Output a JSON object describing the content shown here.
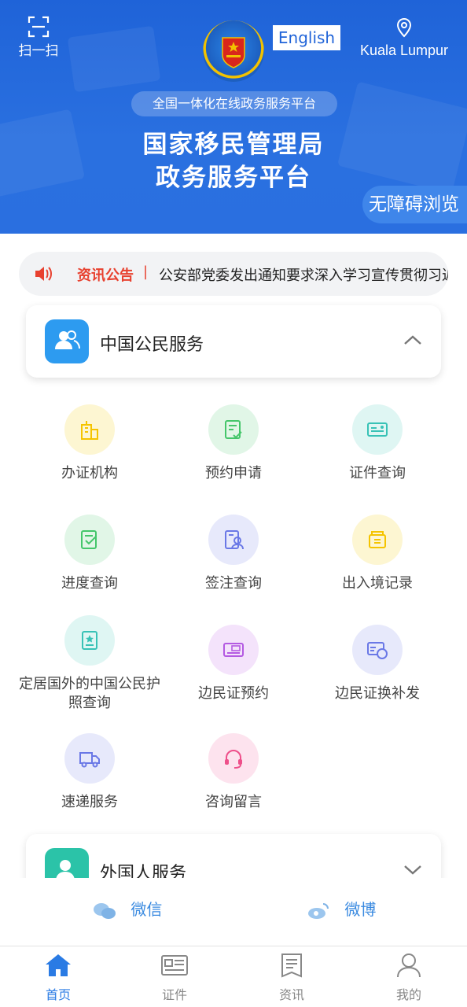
{
  "header": {
    "scan_label": "扫一扫",
    "language_button": "English",
    "location": "Kuala Lumpur",
    "platform_pill": "全国一体化在线政务服务平台",
    "title_line1": "国家移民管理局",
    "title_line2": "政务服务平台",
    "accessibility_button": "无障碍浏览"
  },
  "notice": {
    "tag": "资讯公告",
    "separator": "|",
    "text": "公安部党委发出通知要求深入学习宣传贯彻习近"
  },
  "sections": {
    "citizen_title": "中国公民服务",
    "foreigner_title": "外国人服务"
  },
  "services": [
    {
      "label": "办证机构",
      "icon": "building-icon",
      "color": "#f5c400"
    },
    {
      "label": "预约申请",
      "icon": "form-check-icon",
      "color": "#44c66a"
    },
    {
      "label": "证件查询",
      "icon": "id-card-icon",
      "color": "#38c2b6"
    },
    {
      "label": "进度查询",
      "icon": "progress-check-icon",
      "color": "#44c66a"
    },
    {
      "label": "签注查询",
      "icon": "endorsement-icon",
      "color": "#6a78e6"
    },
    {
      "label": "出入境记录",
      "icon": "record-box-icon",
      "color": "#f5c400"
    },
    {
      "label": "定居国外的中国公民护照查询",
      "icon": "passport-icon",
      "color": "#38c2b6"
    },
    {
      "label": "边民证预约",
      "icon": "border-card-icon",
      "color": "#b45ae2"
    },
    {
      "label": "边民证换补发",
      "icon": "border-card-replace-icon",
      "color": "#6a78e6"
    },
    {
      "label": "速递服务",
      "icon": "truck-icon",
      "color": "#6a78e6"
    },
    {
      "label": "咨询留言",
      "icon": "headset-icon",
      "color": "#ee4f8a"
    }
  ],
  "social": {
    "wechat": "微信",
    "weibo": "微博"
  },
  "nav": {
    "home": "首页",
    "certificates": "证件",
    "news": "资讯",
    "mine": "我的"
  },
  "colors": {
    "primary": "#1f63d8",
    "accent_red": "#e8412f",
    "nav_active": "#2a7be4"
  }
}
